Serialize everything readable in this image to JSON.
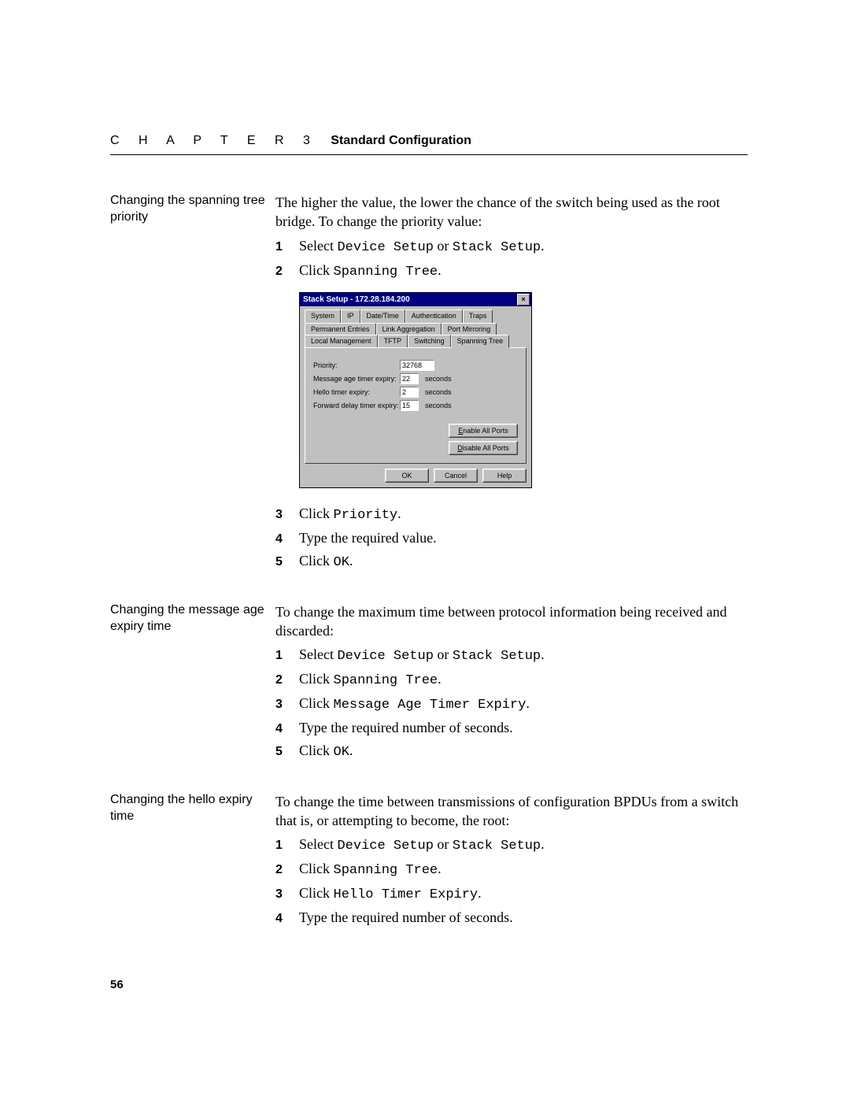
{
  "header": {
    "chapter": "C H A P T E R 3",
    "title": "Standard Configuration"
  },
  "sections": [
    {
      "side": "Changing the spanning tree priority",
      "intro": "The higher the value, the lower the chance of the switch being used as the root bridge. To change the priority value:",
      "steps_a": [
        {
          "n": "1",
          "pre": "Select ",
          "code": "Device Setup",
          "mid": " or ",
          "code2": "Stack Setup",
          "post": "."
        },
        {
          "n": "2",
          "pre": "Click ",
          "code": "Spanning Tree",
          "post": "."
        }
      ],
      "steps_b": [
        {
          "n": "3",
          "pre": "Click ",
          "code": "Priority",
          "post": "."
        },
        {
          "n": "4",
          "pre": "Type the required value.",
          "code": "",
          "post": ""
        },
        {
          "n": "5",
          "pre": "Click ",
          "code": "OK",
          "post": "."
        }
      ]
    },
    {
      "side": "Changing the message age expiry time",
      "intro": "To change the maximum time between protocol information being received and discarded:",
      "steps_a": [
        {
          "n": "1",
          "pre": "Select ",
          "code": "Device Setup",
          "mid": " or ",
          "code2": "Stack Setup",
          "post": "."
        },
        {
          "n": "2",
          "pre": "Click ",
          "code": "Spanning Tree",
          "post": "."
        },
        {
          "n": "3",
          "pre": "Click ",
          "code": "Message Age Timer Expiry",
          "post": "."
        },
        {
          "n": "4",
          "pre": "Type the required number of seconds.",
          "code": "",
          "post": ""
        },
        {
          "n": "5",
          "pre": "Click ",
          "code": "OK",
          "post": "."
        }
      ]
    },
    {
      "side": "Changing the hello expiry time",
      "intro": "To change the time between transmissions of configuration BPDUs from a switch that is, or attempting to become, the root:",
      "steps_a": [
        {
          "n": "1",
          "pre": "Select ",
          "code": "Device Setup",
          "mid": " or ",
          "code2": "Stack Setup",
          "post": "."
        },
        {
          "n": "2",
          "pre": "Click ",
          "code": "Spanning Tree",
          "post": "."
        },
        {
          "n": "3",
          "pre": "Click ",
          "code": "Hello Timer Expiry",
          "post": "."
        },
        {
          "n": "4",
          "pre": "Type the required number of seconds.",
          "code": "",
          "post": ""
        }
      ]
    }
  ],
  "dialog": {
    "title": "Stack Setup - 172.28.184.200",
    "tabs_back": [
      "System",
      "IP",
      "Date/Time",
      "Authentication",
      "Traps"
    ],
    "tabs_front": [
      {
        "label": "Permanent Entries"
      },
      {
        "label": "Link Aggregation"
      },
      {
        "label": "Port Mirroring"
      }
    ],
    "tabs_front2": [
      {
        "label": "Local Management"
      },
      {
        "label": "TFTP"
      },
      {
        "label": "Switching"
      },
      {
        "label": "Spanning Tree",
        "active": true
      }
    ],
    "fields": [
      {
        "label": "Priority:",
        "value": "32768",
        "unit": ""
      },
      {
        "label": "Message age timer expiry:",
        "value": "22",
        "unit": "seconds"
      },
      {
        "label": "Hello timer expiry:",
        "value": "2",
        "unit": "seconds"
      },
      {
        "label": "Forward delay timer expiry:",
        "value": "15",
        "unit": "seconds"
      }
    ],
    "side_buttons": [
      "Enable All Ports",
      "Disable All Ports"
    ],
    "bottom_buttons": [
      "OK",
      "Cancel",
      "Help"
    ]
  },
  "page_number": "56"
}
